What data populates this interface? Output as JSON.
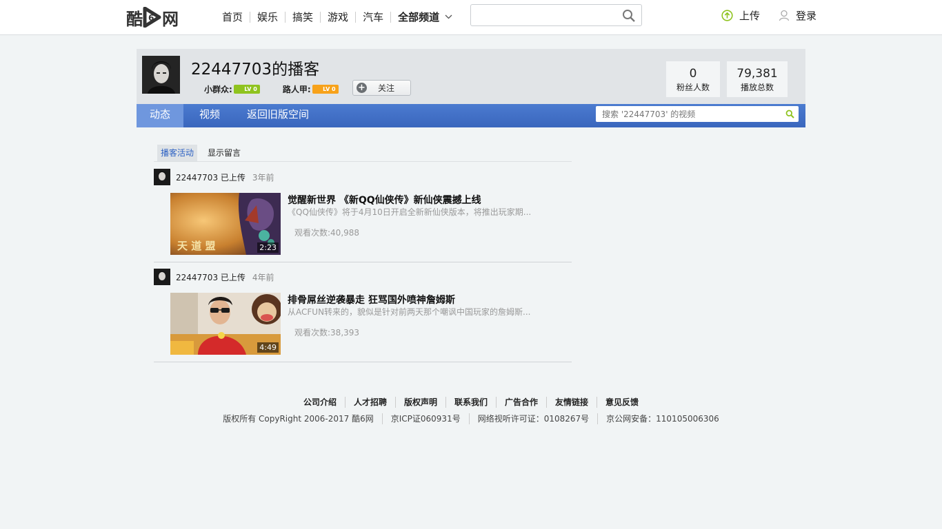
{
  "header": {
    "logo_left": "酷",
    "logo_right": "网",
    "nav": [
      "首页",
      "娱乐",
      "搞笑",
      "游戏",
      "汽车"
    ],
    "nav_all": "全部频道",
    "search_placeholder": "",
    "upload": "上传",
    "login": "登录"
  },
  "profile": {
    "title": "22447703的播客",
    "badge1_label": "小群众:",
    "badge2_label": "路人甲:",
    "follow": "关注",
    "stats": [
      {
        "num": "0",
        "label": "粉丝人数"
      },
      {
        "num": "79,381",
        "label": "播放总数"
      }
    ]
  },
  "tabs": [
    "动态",
    "视频",
    "返回旧版空间"
  ],
  "user_search_placeholder": "搜索 '22447703' 的视频",
  "subtabs": [
    "播客活动",
    "显示留言"
  ],
  "feed": [
    {
      "user": "22447703 已上传",
      "time": "3年前",
      "title": "觉醒新世界 《新QQ仙侠传》新仙侠震撼上线",
      "desc": "《QQ仙侠传》将于4月10日开启全新新仙侠版本，将推出玩家期...",
      "views": "观看次数:40,988",
      "duration": "2:23",
      "thumb_text": "天 道 盟"
    },
    {
      "user": "22447703 已上传",
      "time": "4年前",
      "title": "排骨屌丝逆袭暴走 狂骂国外喷神詹姆斯",
      "desc": "从ACFUN转来的，貌似是针对前两天那个嘲讽中国玩家的詹姆斯...",
      "views": "观看次数:38,393",
      "duration": "4:49"
    }
  ],
  "footer": {
    "links": [
      "公司介绍",
      "人才招聘",
      "版权声明",
      "联系我们",
      "广告合作",
      "友情链接",
      "意见反馈"
    ],
    "copy": [
      "版权所有 CopyRight 2006-2017 酷6网",
      "京ICP证060931号",
      "网络视听许可证：0108267号",
      "京公网安备：110105006306"
    ]
  }
}
